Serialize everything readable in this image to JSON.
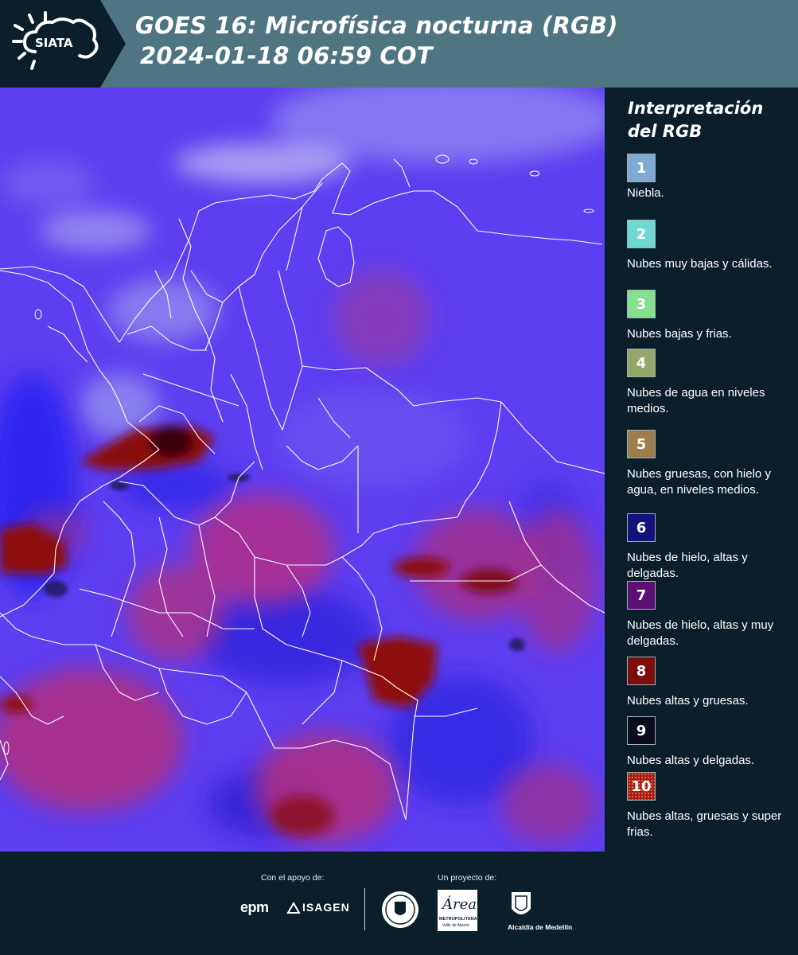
{
  "header": {
    "logo_text": "SIATA",
    "title_line1": "GOES 16: Microfísica nocturna (RGB)",
    "title_line2": "2024-01-18 06:59 COT",
    "colors": {
      "header_bg": "#4f7583",
      "logo_bg": "#0b1f2a"
    }
  },
  "legend": {
    "title": "Interpretación del RGB",
    "items": [
      {
        "number": "1",
        "label": "Niebla.",
        "color": "#7fa9d1"
      },
      {
        "number": "2",
        "label": "Nubes muy bajas y cálidas.",
        "color": "#6fd8d3"
      },
      {
        "number": "3",
        "label": "Nubes bajas y frias.",
        "color": "#84e08e"
      },
      {
        "number": "4",
        "label": "Nubes de agua en niveles medios.",
        "color": "#94a66a"
      },
      {
        "number": "5",
        "label": "Nubes gruesas, con hielo y agua, en niveles medios.",
        "color": "#9c7d4c"
      },
      {
        "number": "6",
        "label": "Nubes de hielo, altas y delgadas.",
        "color": "#14127c"
      },
      {
        "number": "7",
        "label": "Nubes de hielo, altas y muy delgadas.",
        "color": "#5c1075"
      },
      {
        "number": "8",
        "label": "Nubes altas y gruesas.",
        "color": "#7d0c0c"
      },
      {
        "number": "9",
        "label": "Nubes altas y delgadas.",
        "color": "#0b0b1a"
      },
      {
        "number": "10",
        "label": "Nubes altas, gruesas y super frias.",
        "color": "#a81c12"
      }
    ]
  },
  "map": {
    "colors": {
      "background": "#5d3ef0",
      "ocean_blue": "#2a22f0",
      "magenta_clouds": "#b9307a",
      "thick_clouds": "#8e0a0a",
      "fog": "#b8b2ee",
      "boundaries": "#ffffff"
    }
  },
  "footer": {
    "support_caption": "Con el apoyo de:",
    "project_caption": "Un proyecto de:",
    "sponsor_epm": "epm",
    "sponsor_isagen": "ISAGEN",
    "partner_area": "Área",
    "partner_area_sub": "METROPOLITANA",
    "partner_area_sub2": "Valle de Aburrá",
    "partner_alcaldia": "Alcaldía de Medellín"
  }
}
